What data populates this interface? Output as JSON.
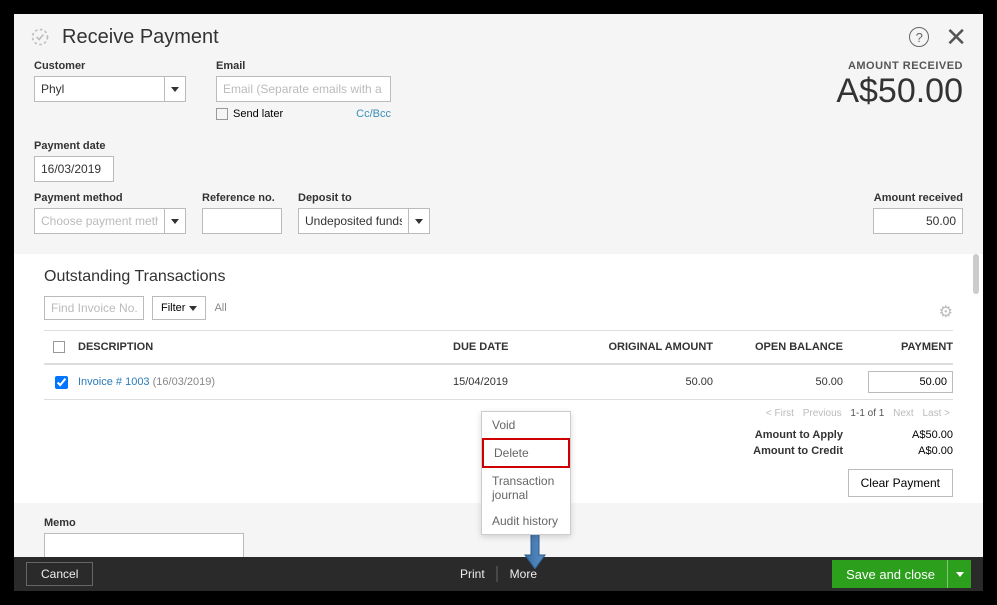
{
  "header": {
    "title": "Receive Payment"
  },
  "customer": {
    "label": "Customer",
    "value": "Phyl"
  },
  "email": {
    "label": "Email",
    "placeholder": "Email (Separate emails with a comma)",
    "send_later": "Send later",
    "ccbcc": "Cc/Bcc"
  },
  "amount_received_header": {
    "label": "AMOUNT RECEIVED",
    "value": "A$50.00"
  },
  "payment_date": {
    "label": "Payment date",
    "value": "16/03/2019"
  },
  "payment_method": {
    "label": "Payment method",
    "placeholder": "Choose payment method"
  },
  "reference_no": {
    "label": "Reference no.",
    "value": ""
  },
  "deposit_to": {
    "label": "Deposit to",
    "value": "Undeposited funds"
  },
  "amount_received_field": {
    "label": "Amount received",
    "value": "50.00"
  },
  "outstanding": {
    "title": "Outstanding Transactions",
    "find_placeholder": "Find Invoice No.",
    "filter_label": "Filter",
    "all_label": "All",
    "columns": {
      "description": "DESCRIPTION",
      "due": "DUE DATE",
      "orig": "ORIGINAL AMOUNT",
      "open": "OPEN BALANCE",
      "pay": "PAYMENT"
    },
    "rows": [
      {
        "checked": true,
        "link": "Invoice # 1003",
        "link_date": "(16/03/2019)",
        "due": "15/04/2019",
        "orig": "50.00",
        "open": "50.00",
        "pay": "50.00"
      }
    ],
    "pager": {
      "first": "< First",
      "prev": "Previous",
      "range": "1-1 of 1",
      "next": "Next",
      "last": "Last >"
    }
  },
  "totals": {
    "apply_label": "Amount to Apply",
    "apply_val": "A$50.00",
    "credit_label": "Amount to Credit",
    "credit_val": "A$0.00",
    "clear": "Clear Payment"
  },
  "memo": {
    "label": "Memo"
  },
  "popup": {
    "void": "Void",
    "delete": "Delete",
    "journal": "Transaction journal",
    "audit": "Audit history"
  },
  "footer": {
    "cancel": "Cancel",
    "print": "Print",
    "more": "More",
    "save": "Save and close"
  }
}
